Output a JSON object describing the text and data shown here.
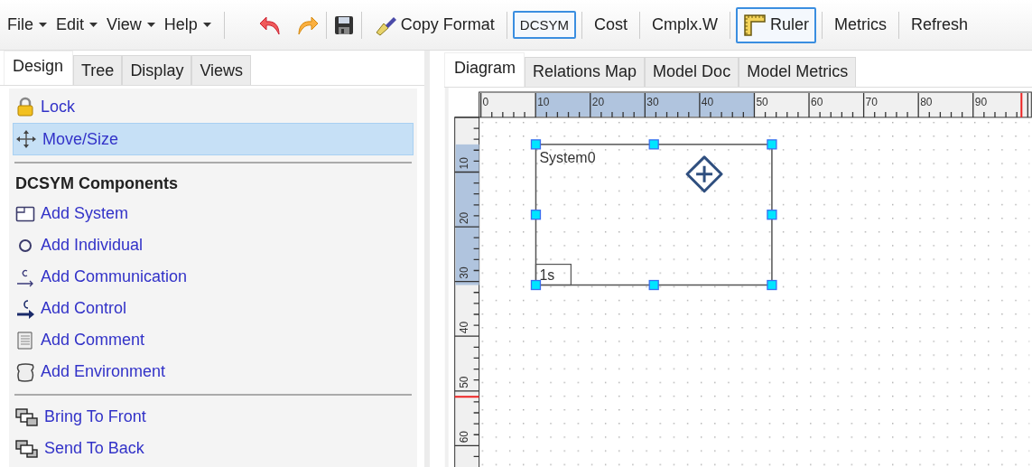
{
  "menu": [
    {
      "label": "File"
    },
    {
      "label": "Edit"
    },
    {
      "label": "View"
    },
    {
      "label": "Help"
    }
  ],
  "toolbar": [
    [
      {
        "kind": "undo"
      },
      {
        "kind": "redo"
      }
    ],
    [
      {
        "kind": "save"
      }
    ],
    [
      {
        "kind": "brush",
        "label": "Copy Format",
        "on": false
      }
    ],
    [
      {
        "kind": "caption",
        "label": "DCSYM",
        "on": true
      }
    ],
    [
      {
        "kind": "text",
        "label": "Cost",
        "on": false
      }
    ],
    [
      {
        "kind": "text",
        "label": "Cmplx.W",
        "on": false
      }
    ],
    [
      {
        "kind": "ruler",
        "label": "Ruler",
        "on": true
      }
    ],
    [
      {
        "kind": "text",
        "label": "Metrics",
        "on": false
      }
    ],
    [
      {
        "kind": "text",
        "label": "Refresh",
        "on": false
      }
    ]
  ],
  "left_tabs": [
    {
      "label": "Design",
      "selected": true
    },
    {
      "label": "Tree",
      "selected": false
    },
    {
      "label": "Display",
      "selected": false
    },
    {
      "label": "Views",
      "selected": false
    }
  ],
  "design_panel": [
    [
      {
        "kind": "lock",
        "label": "Lock",
        "selected": false
      },
      {
        "kind": "move",
        "label": "Move/Size",
        "selected": true
      }
    ],
    [
      {
        "kind": "heading",
        "label": "DCSYM Components"
      },
      {
        "kind": "system",
        "label": "Add System",
        "selected": false
      },
      {
        "kind": "individual",
        "label": "Add Individual",
        "selected": false
      },
      {
        "kind": "communication",
        "label": "Add Communication",
        "selected": false
      },
      {
        "kind": "control",
        "label": "Add Control",
        "selected": false
      },
      {
        "kind": "comment",
        "label": "Add Comment",
        "selected": false
      },
      {
        "kind": "environment",
        "label": "Add Environment",
        "selected": false
      }
    ],
    [
      {
        "kind": "front",
        "label": "Bring To Front",
        "selected": false
      },
      {
        "kind": "back",
        "label": "Send To Back",
        "selected": false
      }
    ]
  ],
  "right_tabs": [
    {
      "label": "Diagram",
      "selected": true
    },
    {
      "label": "Relations Map",
      "selected": false
    },
    {
      "label": "Model Doc",
      "selected": false
    },
    {
      "label": "Model Metrics",
      "selected": false
    }
  ],
  "diagram": {
    "x_ruler": [
      "0",
      "10",
      "20",
      "30",
      "40",
      "50",
      "60",
      "70",
      "80",
      "90"
    ],
    "y_ruler": [
      "10",
      "20",
      "30",
      "40",
      "50",
      "60"
    ],
    "system": {
      "name": "System0",
      "badge": "1s",
      "selected": true
    }
  }
}
